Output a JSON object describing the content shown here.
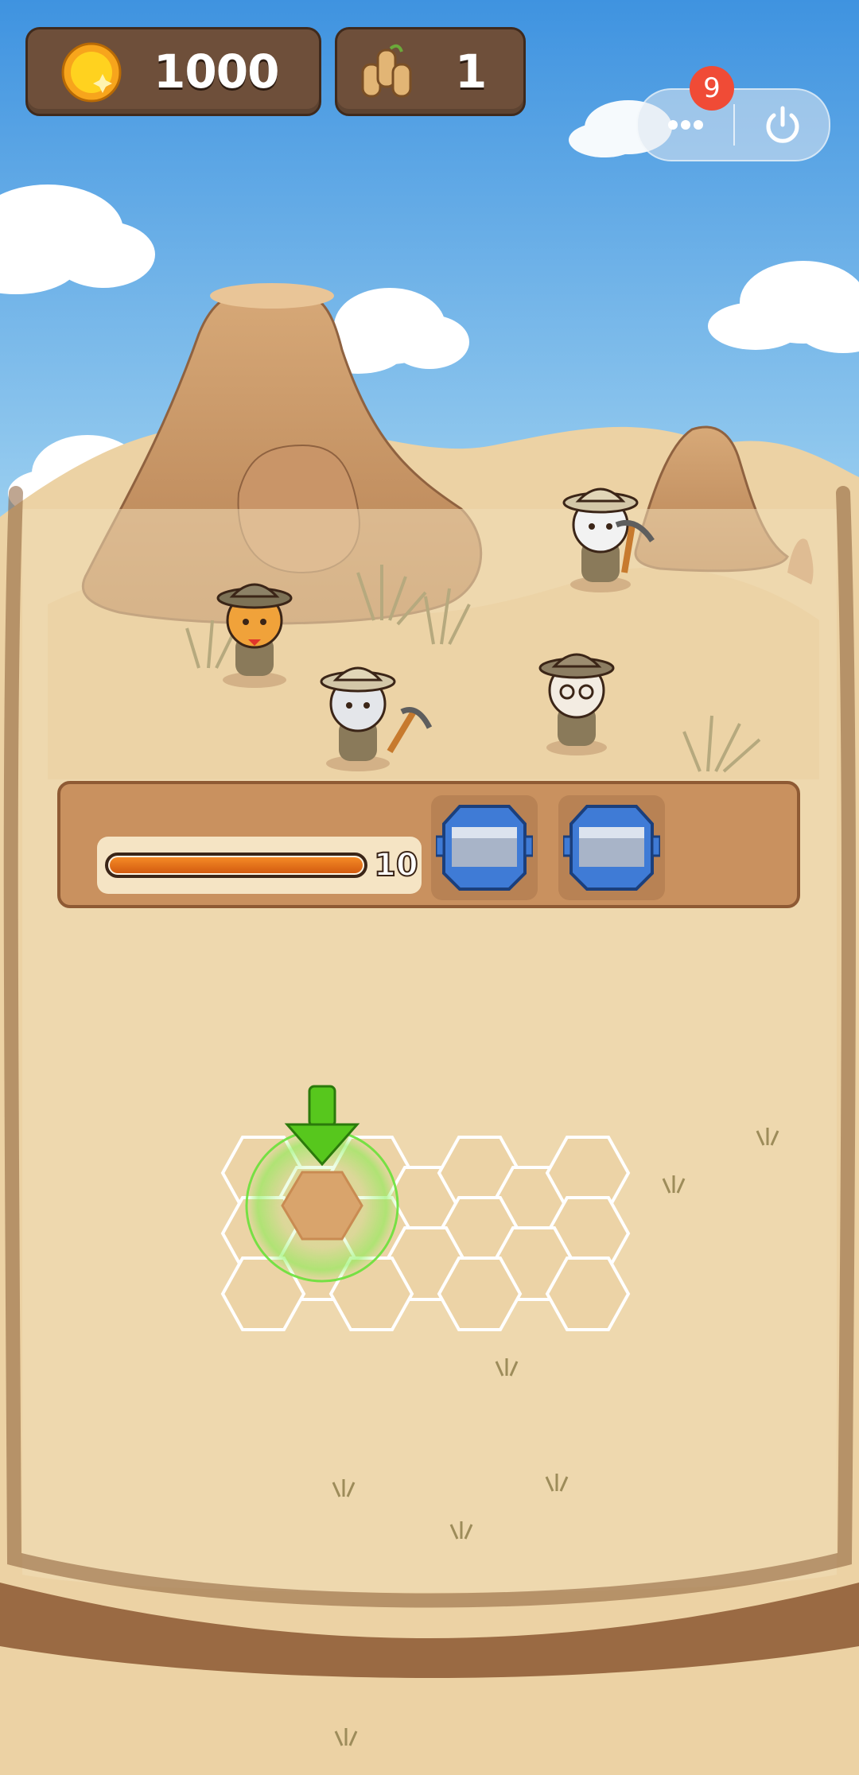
{
  "hud": {
    "coins": "1000",
    "fossils": "1",
    "notification_count": "9",
    "coin_icon": "gold-coin-icon",
    "fossil_icon": "fossil-bones-icon",
    "more_icon": "more-dots-icon",
    "power_icon": "power-icon"
  },
  "dig_progress": {
    "value": "10",
    "fill_fraction": 1.0,
    "slots": [
      "empty-crate-slot",
      "empty-crate-slot"
    ]
  },
  "colors": {
    "sky_top": "#3f93e0",
    "sky_bottom": "#a9d8f2",
    "sand": "#e9cf9e",
    "panel_brown": "#6e4f3a",
    "progress_orange": "#e8741b",
    "badge_red": "#f04b36",
    "hint_green": "#58d42e"
  },
  "characters": [
    {
      "name": "orange-cat-explorer"
    },
    {
      "name": "gray-cat-miner-with-pickaxe"
    },
    {
      "name": "white-cat-miner-with-pickaxe"
    },
    {
      "name": "calico-cat-with-glasses"
    }
  ]
}
